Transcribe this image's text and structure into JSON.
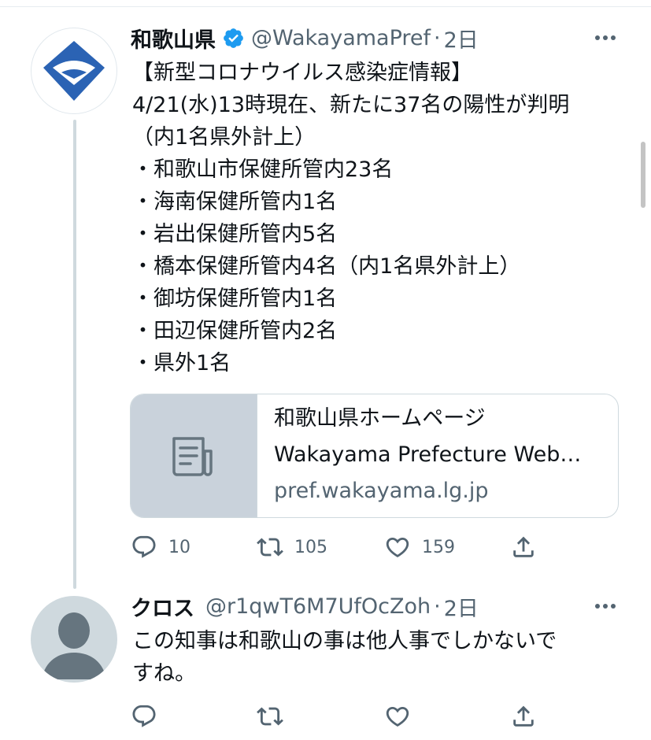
{
  "tweet1": {
    "author_name": "和歌山県",
    "handle": "@WakayamaPref",
    "separator": "·",
    "time": "2日",
    "lines": [
      "【新型コロナウイルス感染症情報】",
      "4/21(水)13時現在、新たに37名の陽性が判明",
      "（内1名県外計上）",
      "・和歌山市保健所管内23名",
      "・海南保健所管内1名",
      "・岩出保健所管内5名",
      "・橋本保健所管内4名（内1名県外計上）",
      "・御坊保健所管内1名",
      "・田辺保健所管内2名",
      "・県外1名"
    ],
    "card": {
      "title_jp": "和歌山県ホームページ",
      "title_en": "Wakayama Prefecture Web…",
      "domain": "pref.wakayama.lg.jp"
    },
    "counts": {
      "replies": "10",
      "retweets": "105",
      "likes": "159"
    }
  },
  "tweet2": {
    "author_name": "クロス",
    "handle": "@r1qwT6M7UfOcZoh",
    "separator": "·",
    "time": "2日",
    "lines": [
      "この知事は和歌山の事は他人事でしかないで",
      "すね。"
    ]
  },
  "colors": {
    "text": "#0f1419",
    "secondary": "#536471",
    "verified": "#1d9bf0",
    "logo_blue": "#2b63b4",
    "thread_line": "#cfd9de"
  },
  "icons": [
    "verified-badge-icon",
    "more-icon",
    "reply-icon",
    "retweet-icon",
    "like-icon",
    "share-icon",
    "document-icon"
  ]
}
